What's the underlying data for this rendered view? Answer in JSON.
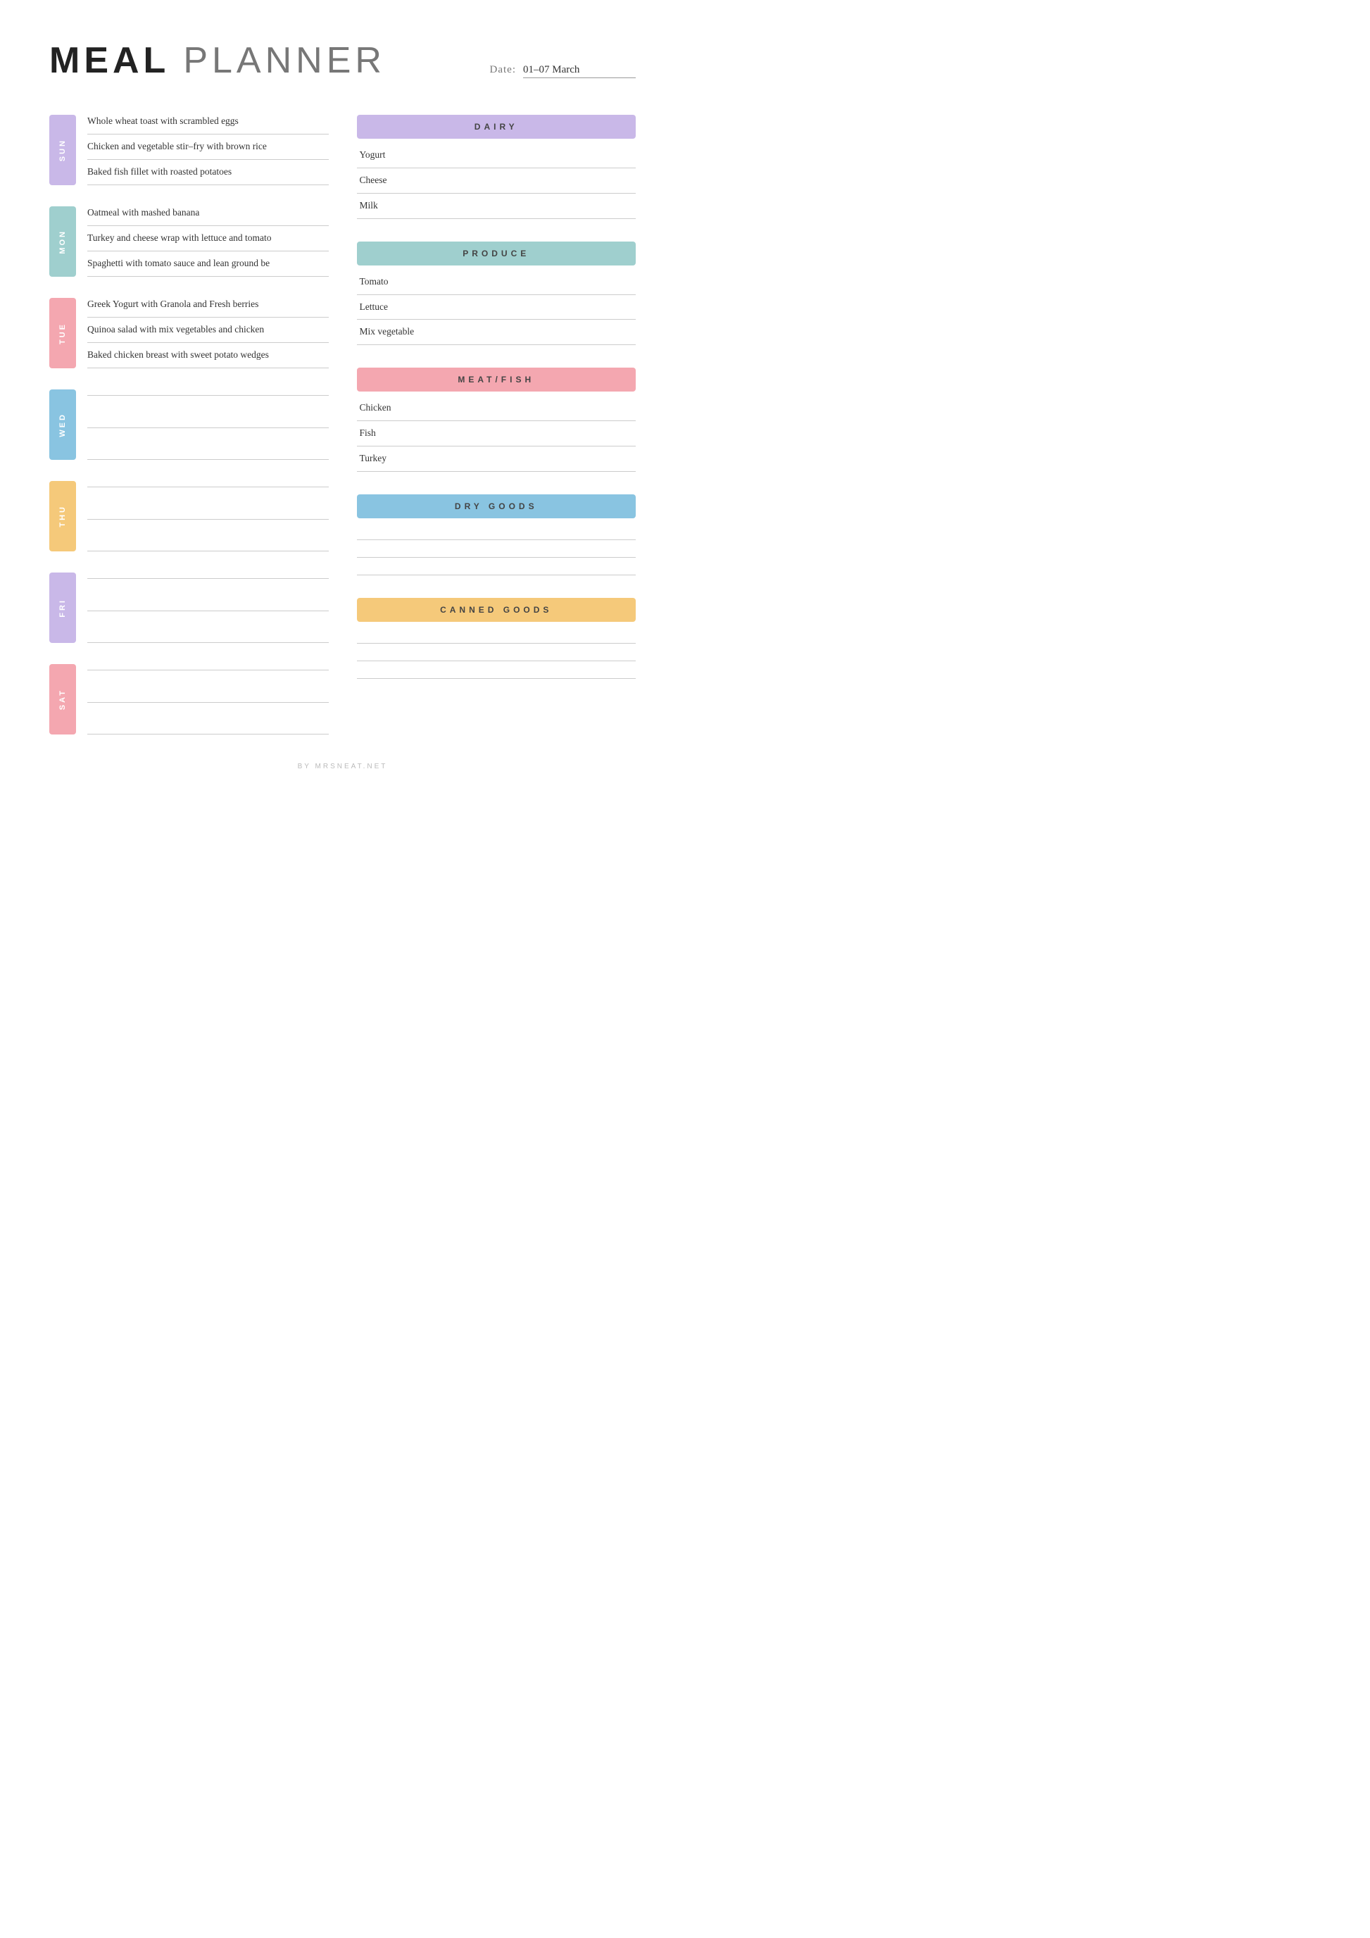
{
  "header": {
    "title_bold": "MEAL",
    "title_light": "PLANNER",
    "date_label": "Date:",
    "date_value": "01–07 March"
  },
  "days": [
    {
      "id": "sun",
      "label": "SUN",
      "color_class": "sun-color",
      "meals": [
        "Whole wheat toast with scrambled eggs",
        "Chicken and vegetable stir–fry with brown rice",
        "Baked fish fillet with roasted potatoes"
      ]
    },
    {
      "id": "mon",
      "label": "MON",
      "color_class": "mon-color",
      "meals": [
        "Oatmeal with mashed banana",
        "Turkey and cheese wrap with lettuce and tomato",
        "Spaghetti with tomato sauce and lean ground be"
      ]
    },
    {
      "id": "tue",
      "label": "TUE",
      "color_class": "tue-color",
      "meals": [
        "Greek Yogurt with Granola and Fresh berries",
        "Quinoa salad with mix vegetables and chicken",
        "Baked chicken breast with sweet potato wedges"
      ]
    },
    {
      "id": "wed",
      "label": "WED",
      "color_class": "wed-color",
      "meals": [
        "",
        "",
        ""
      ]
    },
    {
      "id": "thu",
      "label": "THU",
      "color_class": "thu-color",
      "meals": [
        "",
        "",
        ""
      ]
    },
    {
      "id": "fri",
      "label": "FRI",
      "color_class": "fri-color",
      "meals": [
        "",
        "",
        ""
      ]
    },
    {
      "id": "sat",
      "label": "SAT",
      "color_class": "sat-color",
      "meals": [
        "",
        "",
        ""
      ]
    }
  ],
  "shopping": {
    "sections": [
      {
        "id": "dairy",
        "label": "DAIRY",
        "color_class": "dairy-color",
        "items": [
          "Yogurt",
          "Cheese",
          "Milk"
        ]
      },
      {
        "id": "produce",
        "label": "PRODUCE",
        "color_class": "produce-color",
        "items": [
          "Tomato",
          "Lettuce",
          "Mix vegetable"
        ]
      },
      {
        "id": "meat",
        "label": "MEAT/FISH",
        "color_class": "meat-color",
        "items": [
          "Chicken",
          "Fish",
          "Turkey"
        ]
      },
      {
        "id": "dry",
        "label": "DRY GOODS",
        "color_class": "dry-color",
        "items": [
          "",
          "",
          ""
        ]
      },
      {
        "id": "canned",
        "label": "CANNED GOODS",
        "color_class": "canned-color",
        "items": [
          "",
          "",
          ""
        ]
      }
    ]
  },
  "footer": {
    "text": "BY MRSNEAT.NET"
  }
}
